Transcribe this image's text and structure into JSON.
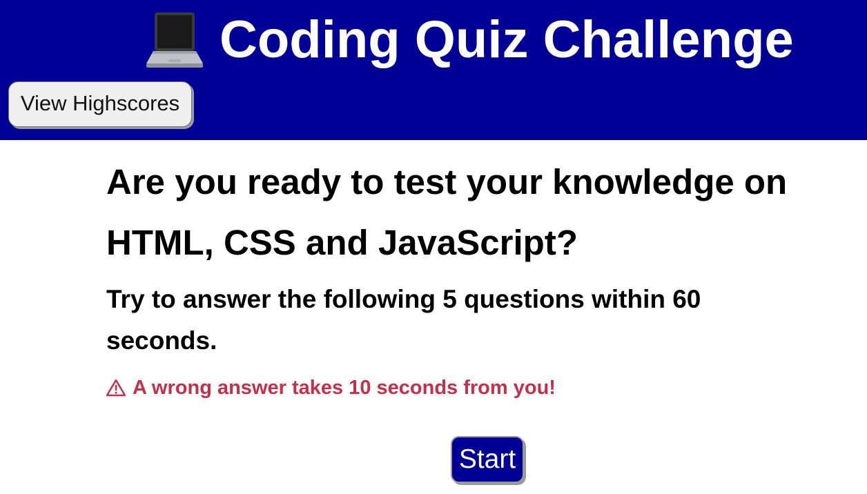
{
  "header": {
    "title": "Coding Quiz Challenge",
    "title_icon": "laptop-icon",
    "view_highscores_label": "View Highscores",
    "background_color": "#000096"
  },
  "main": {
    "heading": "Are you ready to test your knowledge on HTML, CSS and JavaScript?",
    "instructions": "Try to answer the following 5 questions within 60 seconds.",
    "warning_icon": "warning-triangle-icon",
    "warning": "A wrong answer takes 10 seconds from you!",
    "warning_color": "#c62f4a",
    "start_label": "Start"
  }
}
